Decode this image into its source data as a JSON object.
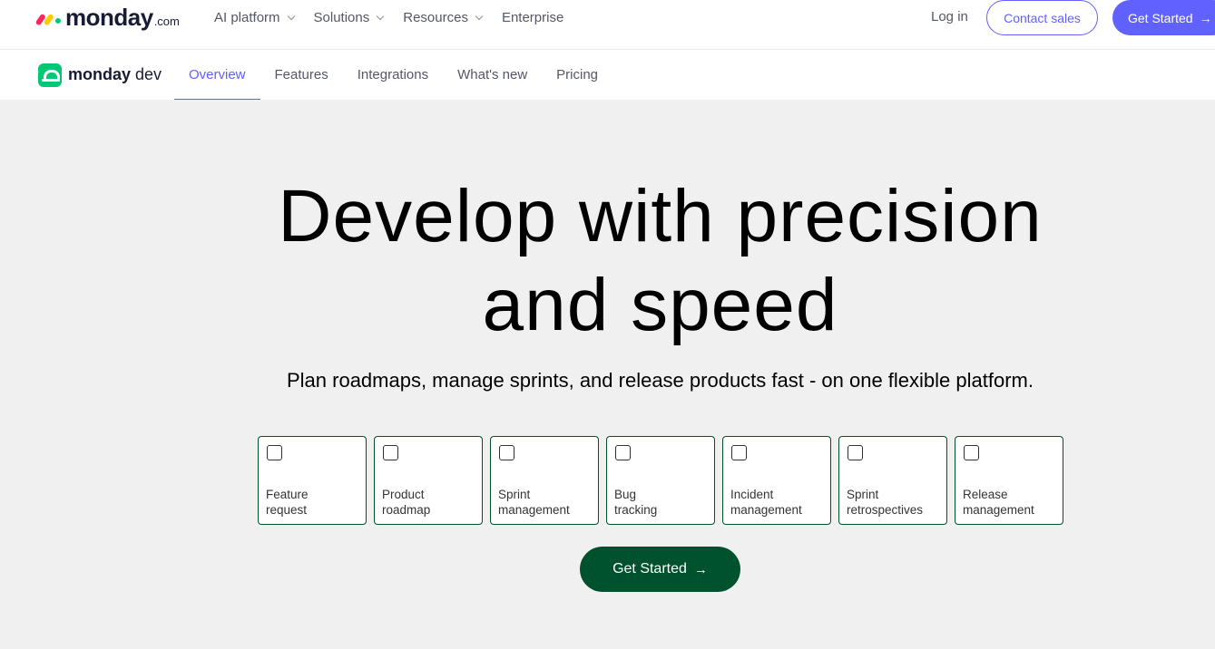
{
  "brand": {
    "name": "monday",
    "suffix": ".com"
  },
  "topnav": {
    "items": [
      {
        "label": "AI platform",
        "dropdown": true
      },
      {
        "label": "Solutions",
        "dropdown": true
      },
      {
        "label": "Resources",
        "dropdown": true
      },
      {
        "label": "Enterprise",
        "dropdown": false
      }
    ],
    "login": "Log in",
    "contact_sales": "Contact sales",
    "get_started": "Get Started"
  },
  "subnav": {
    "product_name": "monday",
    "product_suffix": "dev",
    "tabs": [
      {
        "label": "Overview",
        "active": true
      },
      {
        "label": "Features",
        "active": false
      },
      {
        "label": "Integrations",
        "active": false
      },
      {
        "label": "What's new",
        "active": false
      },
      {
        "label": "Pricing",
        "active": false
      }
    ]
  },
  "hero": {
    "title_line1": "Develop with precision",
    "title_line2": "and speed",
    "subtitle": "Plan roadmaps, manage sprints, and release products fast - on one flexible platform.",
    "options": [
      {
        "label": "Feature\nrequest",
        "checked": false
      },
      {
        "label": "Product\nroadmap",
        "checked": false
      },
      {
        "label": "Sprint\nmanagement",
        "checked": false
      },
      {
        "label": "Bug\ntracking",
        "checked": false
      },
      {
        "label": "Incident\nmanagement",
        "checked": false
      },
      {
        "label": "Sprint\nretrospectives",
        "checked": false
      },
      {
        "label": "Release\nmanagement",
        "checked": false
      }
    ],
    "cta": "Get Started"
  },
  "colors": {
    "accent": "#6161ff",
    "dev_green": "#00c875",
    "cta_green": "#00512d",
    "hero_bg": "#f0f0f0"
  }
}
